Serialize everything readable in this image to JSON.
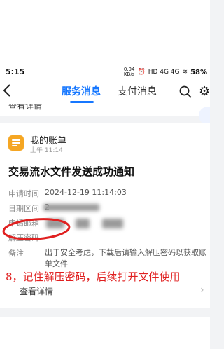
{
  "status_bar": {
    "time": "5:15",
    "network_speed": "0.04\nKB/s",
    "indicators": "HD 4G 4G",
    "battery": "58%"
  },
  "nav": {
    "tabs": [
      {
        "label": "服务消息",
        "active": true
      },
      {
        "label": "支付消息",
        "active": false
      }
    ],
    "accent_color": "#1677ff"
  },
  "prev_card": {
    "view_detail": "查看详情"
  },
  "message": {
    "app_name": "我的账单",
    "time": "上午 11:14",
    "title": "交易流水文件发送成功通知",
    "rows": [
      {
        "label": "申请时间",
        "value": "2024-12-19 11:14:03"
      },
      {
        "label": "日期区间",
        "value": "2"
      },
      {
        "label": "申请邮箱",
        "value": ""
      },
      {
        "label": "解压密码",
        "value": ""
      },
      {
        "label": "备注",
        "value": "出于安全考虑，下载后请输入解压密码以获取账单文件"
      }
    ],
    "view_detail": "查看详情"
  },
  "annotation": {
    "text": "8，记住解压密码，后续打开文件使用",
    "color": "#e02020"
  }
}
